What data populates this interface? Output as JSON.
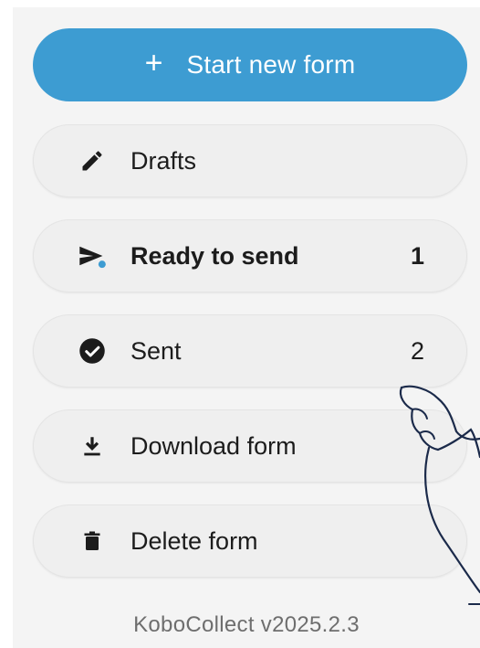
{
  "app": {
    "version": "KoboCollect v2025.2.3"
  },
  "colors": {
    "primary": "#3d9cd2",
    "surface": "#f4f4f4",
    "button": "#efefef",
    "text": "#1c1c1c",
    "badge_dot": "#3d9cd2"
  },
  "menu": {
    "start_new_form": {
      "label": "Start new form",
      "icon": "plus-icon"
    },
    "drafts": {
      "label": "Drafts",
      "icon": "pencil-icon"
    },
    "ready_to_send": {
      "label": "Ready to send",
      "count": "1",
      "icon": "send-icon"
    },
    "sent": {
      "label": "Sent",
      "count": "2",
      "icon": "check-circle-icon"
    },
    "download_form": {
      "label": "Download form",
      "icon": "download-icon"
    },
    "delete_form": {
      "label": "Delete form",
      "icon": "trash-icon"
    }
  }
}
